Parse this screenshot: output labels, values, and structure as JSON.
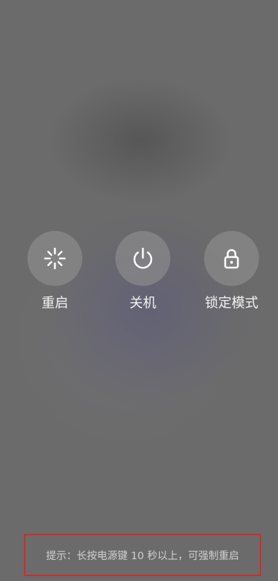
{
  "power_menu": {
    "actions": [
      {
        "label": "重启",
        "icon": "restart-icon"
      },
      {
        "label": "关机",
        "icon": "power-icon"
      },
      {
        "label": "锁定模式",
        "icon": "lock-icon"
      }
    ]
  },
  "hint": {
    "text": "提示：长按电源键 10 秒以上，可强制重启"
  },
  "colors": {
    "background": "#6b6b6b",
    "button_circle": "#969696",
    "label_text": "#f2f2f2",
    "hint_text": "#d0d0d0",
    "highlight_border": "#d42a2a"
  }
}
